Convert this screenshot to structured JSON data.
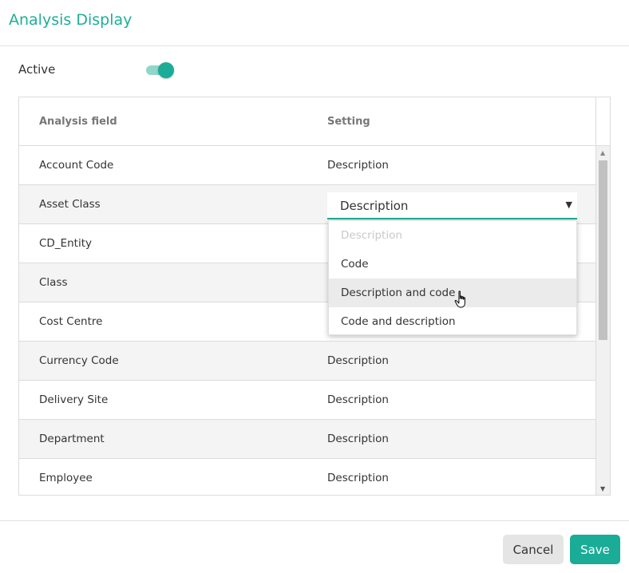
{
  "dialog": {
    "title": "Analysis Display",
    "active_label": "Active",
    "active_on": true
  },
  "grid": {
    "headers": [
      "Analysis field",
      "Setting"
    ],
    "rows": [
      {
        "field": "Account Code",
        "setting": "Description"
      },
      {
        "field": "Asset Class",
        "setting": "Description"
      },
      {
        "field": "CD_Entity",
        "setting": ""
      },
      {
        "field": "Class",
        "setting": ""
      },
      {
        "field": "Cost Centre",
        "setting": ""
      },
      {
        "field": "Currency Code",
        "setting": "Description"
      },
      {
        "field": "Delivery Site",
        "setting": "Description"
      },
      {
        "field": "Department",
        "setting": "Description"
      },
      {
        "field": "Employee",
        "setting": "Description"
      }
    ]
  },
  "dropdown": {
    "selected": "Description",
    "options": [
      "Description",
      "Code",
      "Description and code",
      "Code and description"
    ],
    "hovered": "Description and code"
  },
  "footer": {
    "cancel_label": "Cancel",
    "save_label": "Save"
  },
  "colors": {
    "accent": "#1aac96",
    "title": "#1fae98"
  }
}
